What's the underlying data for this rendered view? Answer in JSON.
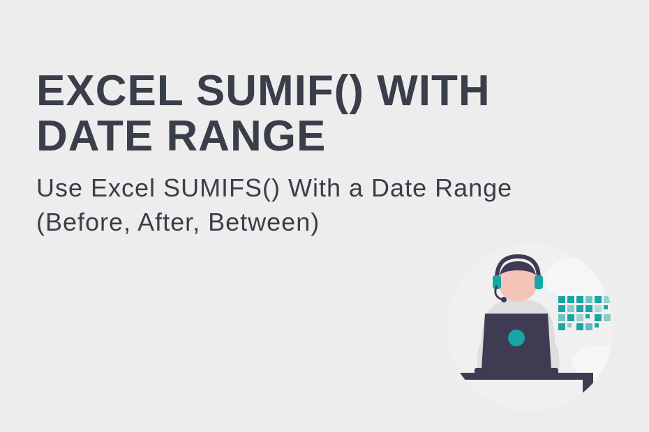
{
  "title": "EXCEL SUMIF() WITH DATE RANGE",
  "subtitle": "Use Excel SUMIFS() With a Date Range (Before, After, Between)"
}
